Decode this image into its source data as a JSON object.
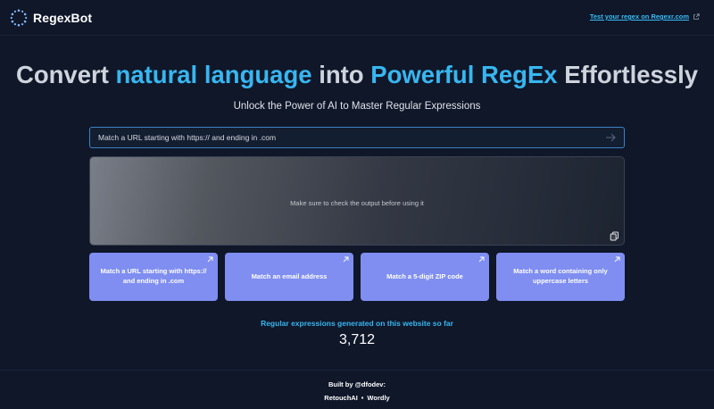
{
  "header": {
    "brand": "RegexBot",
    "external_link": "Test your regex on Regexr.com"
  },
  "hero": {
    "title_part1": "Convert ",
    "title_accent1": "natural language",
    "title_part2": " into ",
    "title_accent2": "Powerful RegEx",
    "title_part3": " Effortlessly",
    "subtitle": "Unlock the Power of AI to Master Regular Expressions"
  },
  "prompt": {
    "value": "Match a URL starting with https:// and ending in .com"
  },
  "output": {
    "placeholder": "Make sure to check the output before using it"
  },
  "examples": [
    {
      "label": "Match a URL starting with https:// and ending in .com"
    },
    {
      "label": "Match an email address"
    },
    {
      "label": "Match a 5-digit ZIP code"
    },
    {
      "label": "Match a word containing only uppercase letters"
    }
  ],
  "stats": {
    "label": "Regular expressions generated on this website so far",
    "count": "3,712"
  },
  "footer": {
    "built_by": "Built by @dfodev:",
    "links": [
      {
        "label": "RetouchAI"
      },
      {
        "label": "Wordly"
      }
    ],
    "separator": "•"
  },
  "colors": {
    "background": "#0f1729",
    "accent": "#38b6f0",
    "card": "#7f8ef0",
    "input_border": "#3b82c4"
  },
  "icons": {
    "logo": "dotted-ring-icon",
    "external": "external-link-icon",
    "send": "arrow-right-icon",
    "copy": "copy-icon",
    "card": "arrow-up-right-icon"
  }
}
